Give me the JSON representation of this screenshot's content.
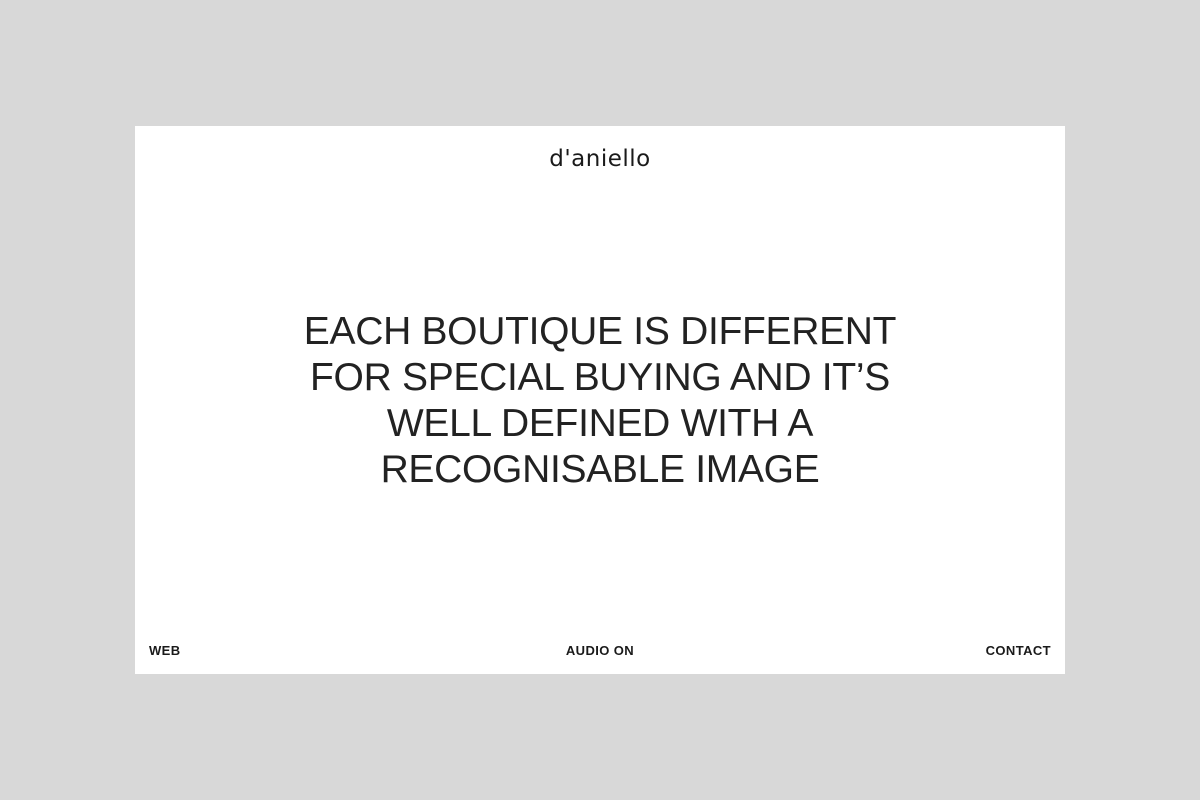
{
  "header": {
    "logo_text": "d'aniello"
  },
  "main": {
    "headline_lines": [
      "EACH BOUTIQUE IS DIFFERENT",
      "FOR SPECIAL BUYING AND IT’S",
      "WELL DEFINED WITH A",
      "RECOGNISABLE IMAGE"
    ]
  },
  "footer": {
    "left_label": "WEB",
    "center_label": "AUDIO ON",
    "right_label": "CONTACT"
  },
  "colors": {
    "background": "#d8d8d8",
    "screen": "#ffffff",
    "text": "#222222"
  }
}
